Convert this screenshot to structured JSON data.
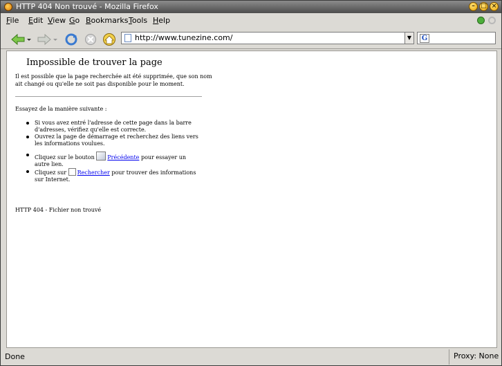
{
  "window": {
    "title": "HTTP 404 Non trouvé - Mozilla Firefox"
  },
  "menu": [
    {
      "label": "File",
      "key": "F"
    },
    {
      "label": "Edit",
      "key": "E"
    },
    {
      "label": "View",
      "key": "V"
    },
    {
      "label": "Go",
      "key": "G"
    },
    {
      "label": "Bookmarks",
      "key": "B"
    },
    {
      "label": "Tools",
      "key": "T"
    },
    {
      "label": "Help",
      "key": "H"
    }
  ],
  "address": {
    "url": "http://www.tunezine.com/"
  },
  "search": {
    "engine_glyph": "G"
  },
  "page": {
    "heading": "Impossible de trouver la page",
    "intro": "Il est possible que la page recherchée ait été supprimée, que son nom ait changé ou qu'elle ne soit pas disponible pour le moment.",
    "try_label": "Essayez de la manière suivante :",
    "bullet1": "Si vous avez entré l'adresse de cette page dans la barre d'adresses, vérifiez qu'elle est correcte.",
    "bullet2": "Ouvrez la page de démarrage et recherchez des liens vers les informations voulues.",
    "bullet3_pre": "Cliquez sur le bouton",
    "bullet3_link": "Précédente",
    "bullet3_post": "pour essayer un autre lien.",
    "bullet4_pre": "Cliquez sur",
    "bullet4_link": "Rechercher",
    "bullet4_post": "pour trouver des informations sur Internet.",
    "footer": "HTTP 404 - Fichier non trouvé"
  },
  "status": {
    "text": "Done",
    "proxy": "Proxy: None"
  }
}
